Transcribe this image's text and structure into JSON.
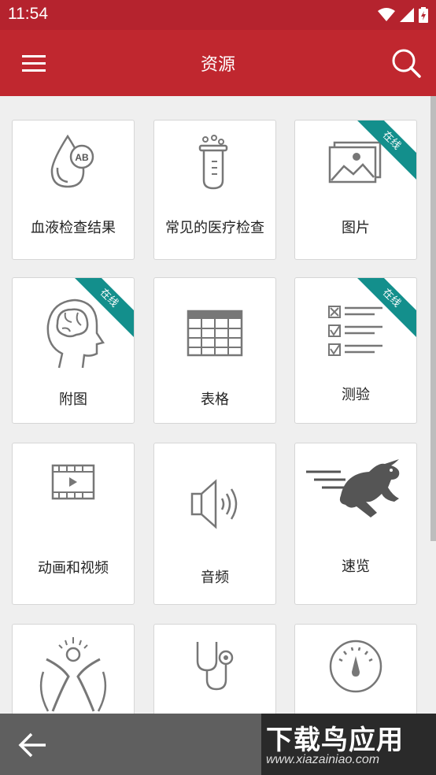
{
  "status_bar": {
    "time": "11:54"
  },
  "app_bar": {
    "title": "资源"
  },
  "tiles": [
    {
      "label": "血液检查结果",
      "icon": "blood-drop-icon"
    },
    {
      "label": "常见的医疗检查",
      "icon": "test-tube-icon"
    },
    {
      "label": "图片",
      "icon": "image-icon",
      "badge": "在线"
    },
    {
      "label": "附图",
      "icon": "brain-head-icon",
      "badge": "在线"
    },
    {
      "label": "表格",
      "icon": "table-icon"
    },
    {
      "label": "测验",
      "icon": "checklist-icon",
      "badge": "在线"
    },
    {
      "label": "动画和视频",
      "icon": "film-strip-icon"
    },
    {
      "label": "音频",
      "icon": "speaker-icon"
    },
    {
      "label": "速览",
      "icon": "rabbit-icon"
    },
    {
      "label": "",
      "icon": "human-figure-icon"
    },
    {
      "label": "",
      "icon": "stethoscope-icon"
    },
    {
      "label": "",
      "icon": "gauge-icon"
    }
  ],
  "watermark": {
    "title": "下载鸟应用",
    "url": "www.xiazainiao.com"
  },
  "colors": {
    "primary": "#c0272f",
    "ribbon": "#138f8c",
    "bottom_bar": "#5f5f5f"
  }
}
